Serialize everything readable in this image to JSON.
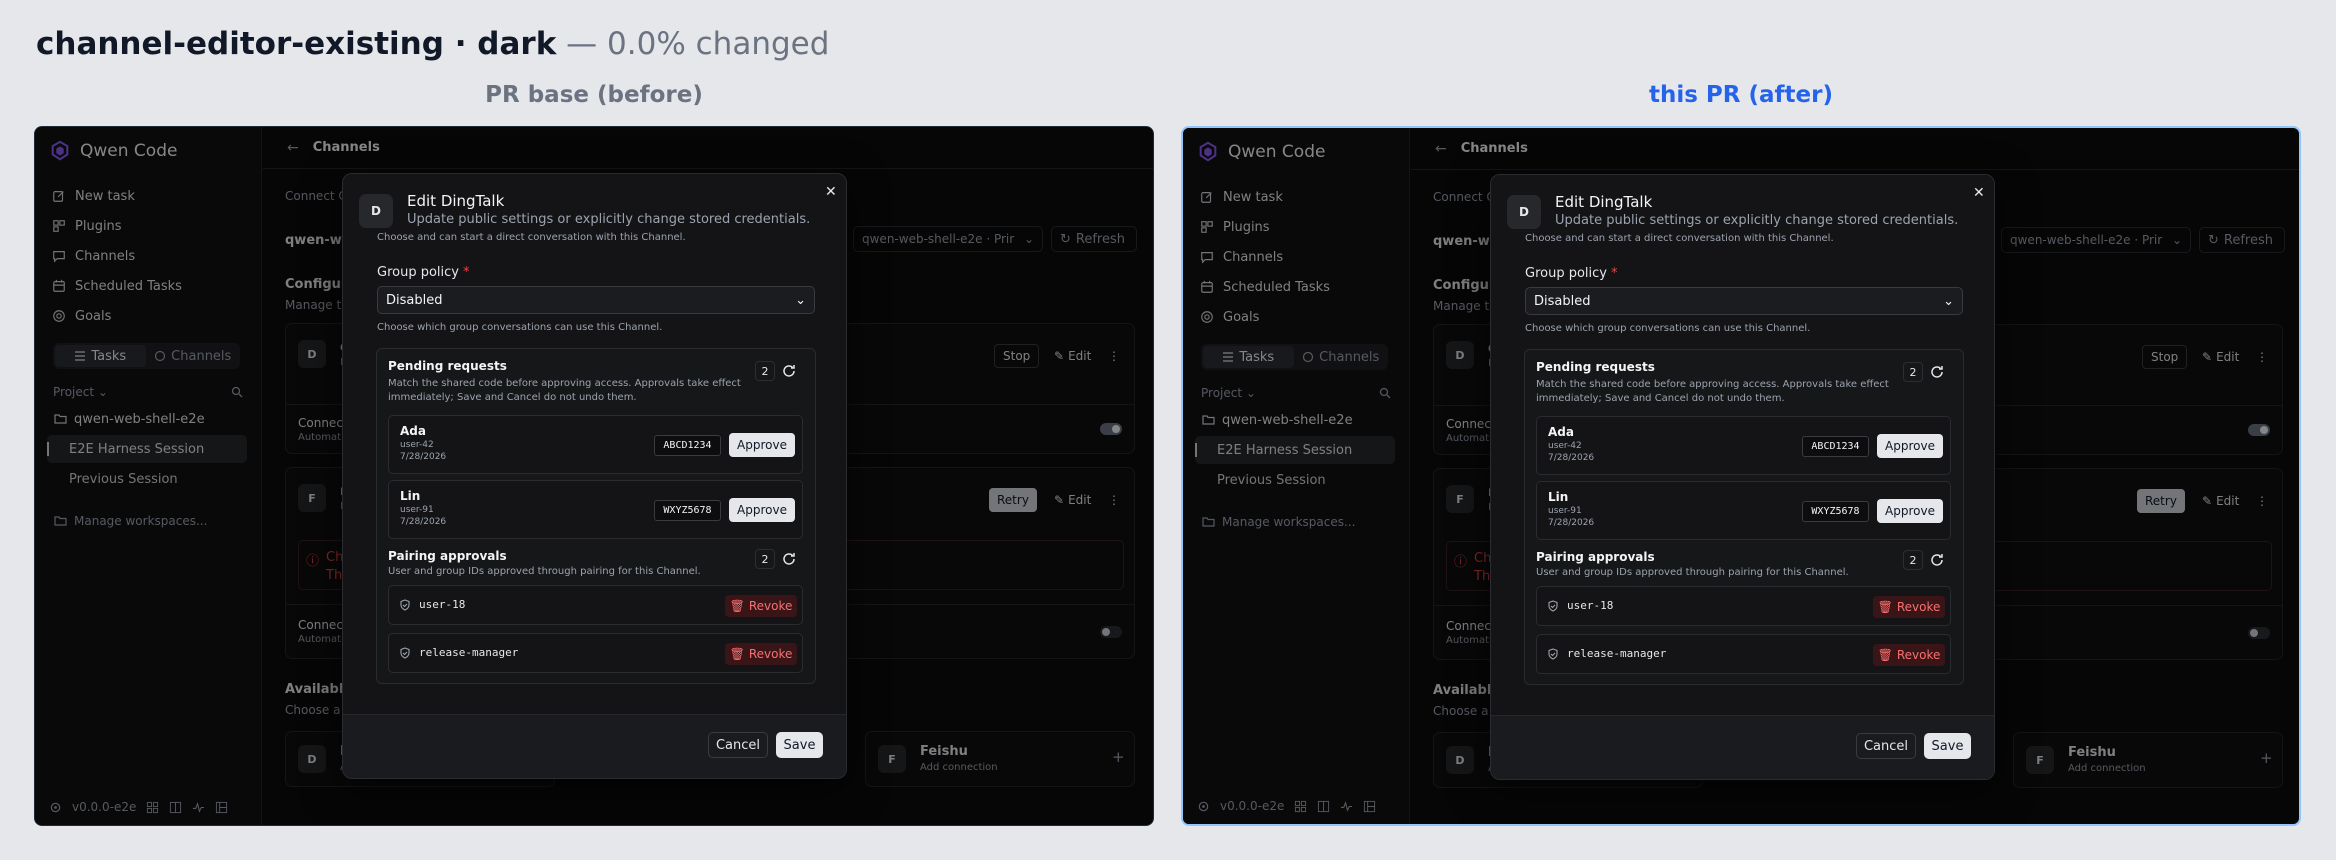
{
  "header": {
    "title": "channel-editor-existing · dark",
    "suffix": "— 0.0% changed",
    "label_before": "PR base (before)",
    "label_after": "this PR (after)"
  },
  "app": {
    "name": "Qwen Code",
    "version": "v0.0.0-e2e"
  },
  "sidebar": {
    "nav": [
      {
        "label": "New task",
        "icon": "edit-icon"
      },
      {
        "label": "Plugins",
        "icon": "plugin-icon"
      },
      {
        "label": "Channels",
        "icon": "chat-icon"
      },
      {
        "label": "Scheduled Tasks",
        "icon": "calendar-icon"
      },
      {
        "label": "Goals",
        "icon": "target-icon"
      }
    ],
    "toggle_tasks": "Tasks",
    "toggle_channels": "Channels",
    "project_label": "Project",
    "workspace": "qwen-web-shell-e2e",
    "sessions": [
      "E2E Harness Session",
      "Previous Session"
    ],
    "manage": "Manage workspaces..."
  },
  "main": {
    "back": "←",
    "title": "Channels",
    "connect_text": "Connect Q",
    "workspace_name": "qwen-we",
    "selector": "qwen-web-shell-e2e · Prir",
    "refresh": "Refresh",
    "configured_title": "Configur",
    "configured_desc": "Manage the",
    "card1_initial": "D",
    "card1_name": "d",
    "card1_sub": "D",
    "stop": "Stop",
    "edit": "Edit",
    "connect_label": "Connect",
    "automation_label": "Automatio",
    "card2_initial": "F",
    "card2_name": "r",
    "card2_sub": "F",
    "retry": "Retry",
    "error_line1": "Ch",
    "error_line2": "The",
    "available_title": "Availabl",
    "available_desc": "Choose a p",
    "avail_d_initial": "D",
    "avail_d_name": "D",
    "avail_d_sub": "A",
    "feishu_initial": "F",
    "feishu_name": "Feishu",
    "feishu_sub": "Add connection"
  },
  "modal": {
    "avatar": "D",
    "title": "Edit DingTalk",
    "subtitle": "Update public settings or explicitly change stored credentials.",
    "cut_text": "Choose and can start a direct conversation with this Channel.",
    "group_policy_label": "Group policy",
    "required_mark": "*",
    "group_policy_value": "Disabled",
    "group_policy_help": "Choose which group conversations can use this Channel.",
    "pending": {
      "title": "Pending requests",
      "desc": "Match the shared code before approving access. Approvals take effect immediately; Save and Cancel do not undo them.",
      "count": "2",
      "items": [
        {
          "name": "Ada",
          "id": "user-42",
          "date": "7/28/2026",
          "code": "ABCD1234",
          "action": "Approve"
        },
        {
          "name": "Lin",
          "id": "user-91",
          "date": "7/28/2026",
          "code": "WXYZ5678",
          "action": "Approve"
        }
      ]
    },
    "pairing": {
      "title": "Pairing approvals",
      "desc": "User and group IDs approved through pairing for this Channel.",
      "count": "2",
      "items": [
        {
          "user": "user-18",
          "action": "Revoke"
        },
        {
          "user": "release-manager",
          "action": "Revoke"
        }
      ]
    },
    "cancel": "Cancel",
    "save": "Save"
  },
  "colors": {
    "accent_after": "#2563eb",
    "revoke": "#f87171",
    "error": "#ef4444"
  }
}
